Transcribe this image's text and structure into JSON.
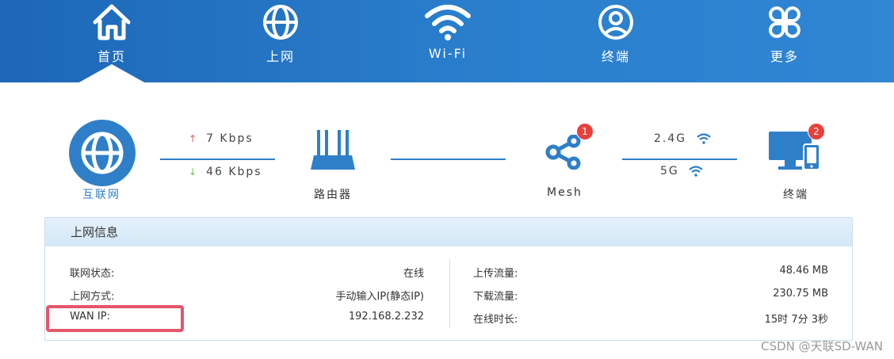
{
  "nav": {
    "items": [
      {
        "label": "首页",
        "icon": "home-icon"
      },
      {
        "label": "上网",
        "icon": "globe-icon"
      },
      {
        "label": "Wi-Fi",
        "icon": "wifi-icon"
      },
      {
        "label": "终端",
        "icon": "user-circle-icon"
      },
      {
        "label": "更多",
        "icon": "more-grid-icon"
      }
    ],
    "active": "首页"
  },
  "topology": {
    "internet_label": "互联网",
    "upload_rate": "7 Kbps",
    "download_rate": "46 Kbps",
    "router_label": "路由器",
    "mesh_label": "Mesh",
    "mesh_badge": "1",
    "band_24": "2.4G",
    "band_5": "5G",
    "terminal_label": "终端",
    "terminal_badge": "2"
  },
  "info": {
    "title": "上网信息",
    "left": [
      {
        "label": "联网状态:",
        "value": "在线"
      },
      {
        "label": "上网方式:",
        "value": "手动输入IP(静态IP)"
      },
      {
        "label": "WAN IP:",
        "value": "192.168.2.232"
      }
    ],
    "right": [
      {
        "label": "上传流量:",
        "value": "48.46 MB"
      },
      {
        "label": "下载流量:",
        "value": "230.75 MB"
      },
      {
        "label": "在线时长:",
        "value": "15时 7分 3秒"
      }
    ]
  },
  "watermark": "CSDN @天联SD-WAN",
  "colors": {
    "nav_start": "#1d67b8",
    "nav_end": "#2f86d3",
    "accent": "#2f7fc8",
    "badge": "#e8403a",
    "highlight": "#e4566b"
  }
}
